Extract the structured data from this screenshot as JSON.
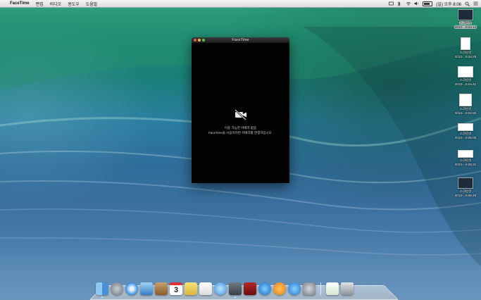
{
  "menubar": {
    "apple_glyph": "",
    "app_name": "FaceTime",
    "menus": [
      "편집",
      "비디오",
      "윈도우",
      "도움말"
    ],
    "clock": "(일) 오후 8:06",
    "status_icons": [
      "keyboard-icon",
      "bluetooth-icon",
      "wifi-icon",
      "volume-icon",
      "battery-icon",
      "search-icon",
      "list-icon"
    ]
  },
  "window": {
    "title": "FaceTime",
    "message_line1": "이용 가능한 카메라 없음",
    "message_line2": "FaceTime을 사용하려면 카메라를 연결하십시오.",
    "icon": "camera-off-icon"
  },
  "desktop": {
    "icons": [
      {
        "label1": "스크린샷",
        "label2": "2013-...8.04.12",
        "selected": true
      },
      {
        "label1": "스크린샷",
        "label2": "2013-...8.04.29",
        "selected": false
      },
      {
        "label1": "스크린샷",
        "label2": "2013-...8.04.41",
        "selected": false
      },
      {
        "label1": "스크린샷",
        "label2": "2013-...8.04.50",
        "selected": false
      },
      {
        "label1": "스크린샷",
        "label2": "2013-...8.06.05",
        "selected": false
      },
      {
        "label1": "스크린샷",
        "label2": "2013-...8.06.31",
        "selected": false
      },
      {
        "label1": "스크린샷",
        "label2": "2013-...8.06.48",
        "selected": false
      }
    ]
  },
  "dock": {
    "calendar_day": "3",
    "items": [
      "finder-icon",
      "launchpad-icon",
      "safari-icon",
      "mail-icon",
      "contacts-icon",
      "calendar-icon",
      "notes-icon",
      "reminders-icon",
      "messages-icon",
      "facetime-icon",
      "photobooth-icon",
      "itunes-icon",
      "ibooks-icon",
      "appstore-icon",
      "system-preferences-icon",
      "documents-icon",
      "trash-icon"
    ]
  },
  "colors": {
    "window_bg": "#020202",
    "menubar_bg": "#e8e8e8",
    "close": "#ee5a52",
    "minimize": "#f0b43a",
    "maximize": "#5cc04a"
  }
}
